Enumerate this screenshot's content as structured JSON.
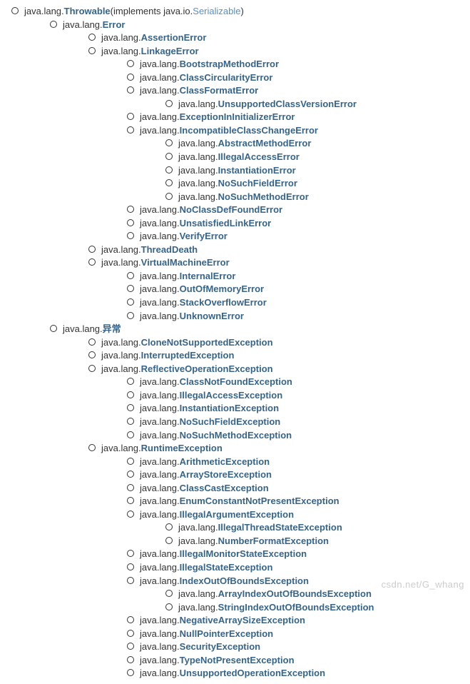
{
  "pkg_prefix": "java.lang.",
  "implements_open": " (implements java.io.",
  "implements_iface": "Serializable",
  "implements_close": ")",
  "watermark": "csdn.net/G_whang",
  "tree": [
    {
      "name": "Throwable",
      "suffix_note": " (implements java.io.Serializable)",
      "children": [
        {
          "name": "Error",
          "children": [
            {
              "name": "AssertionError"
            },
            {
              "name": "LinkageError",
              "children": [
                {
                  "name": "BootstrapMethodError"
                },
                {
                  "name": "ClassCircularityError"
                },
                {
                  "name": "ClassFormatError",
                  "children": [
                    {
                      "name": "UnsupportedClassVersionError"
                    }
                  ]
                },
                {
                  "name": "ExceptionInInitializerError"
                },
                {
                  "name": "IncompatibleClassChangeError",
                  "children": [
                    {
                      "name": "AbstractMethodError"
                    },
                    {
                      "name": "IllegalAccessError"
                    },
                    {
                      "name": "InstantiationError"
                    },
                    {
                      "name": "NoSuchFieldError"
                    },
                    {
                      "name": "NoSuchMethodError"
                    }
                  ]
                },
                {
                  "name": "NoClassDefFoundError"
                },
                {
                  "name": "UnsatisfiedLinkError"
                },
                {
                  "name": "VerifyError"
                }
              ]
            },
            {
              "name": "ThreadDeath"
            },
            {
              "name": "VirtualMachineError",
              "children": [
                {
                  "name": "InternalError"
                },
                {
                  "name": "OutOfMemoryError"
                },
                {
                  "name": "StackOverflowError"
                },
                {
                  "name": "UnknownError"
                }
              ]
            }
          ]
        },
        {
          "name": "异常",
          "children": [
            {
              "name": "CloneNotSupportedException"
            },
            {
              "name": "InterruptedException"
            },
            {
              "name": "ReflectiveOperationException",
              "children": [
                {
                  "name": "ClassNotFoundException"
                },
                {
                  "name": "IllegalAccessException"
                },
                {
                  "name": "InstantiationException"
                },
                {
                  "name": "NoSuchFieldException"
                },
                {
                  "name": "NoSuchMethodException"
                }
              ]
            },
            {
              "name": "RuntimeException",
              "children": [
                {
                  "name": "ArithmeticException"
                },
                {
                  "name": "ArrayStoreException"
                },
                {
                  "name": "ClassCastException"
                },
                {
                  "name": "EnumConstantNotPresentException"
                },
                {
                  "name": "IllegalArgumentException",
                  "children": [
                    {
                      "name": "IllegalThreadStateException"
                    },
                    {
                      "name": "NumberFormatException"
                    }
                  ]
                },
                {
                  "name": "IllegalMonitorStateException"
                },
                {
                  "name": "IllegalStateException"
                },
                {
                  "name": "IndexOutOfBoundsException",
                  "children": [
                    {
                      "name": "ArrayIndexOutOfBoundsException"
                    },
                    {
                      "name": "StringIndexOutOfBoundsException"
                    }
                  ]
                },
                {
                  "name": "NegativeArraySizeException"
                },
                {
                  "name": "NullPointerException"
                },
                {
                  "name": "SecurityException"
                },
                {
                  "name": "TypeNotPresentException"
                },
                {
                  "name": "UnsupportedOperationException"
                }
              ]
            }
          ]
        }
      ]
    }
  ]
}
